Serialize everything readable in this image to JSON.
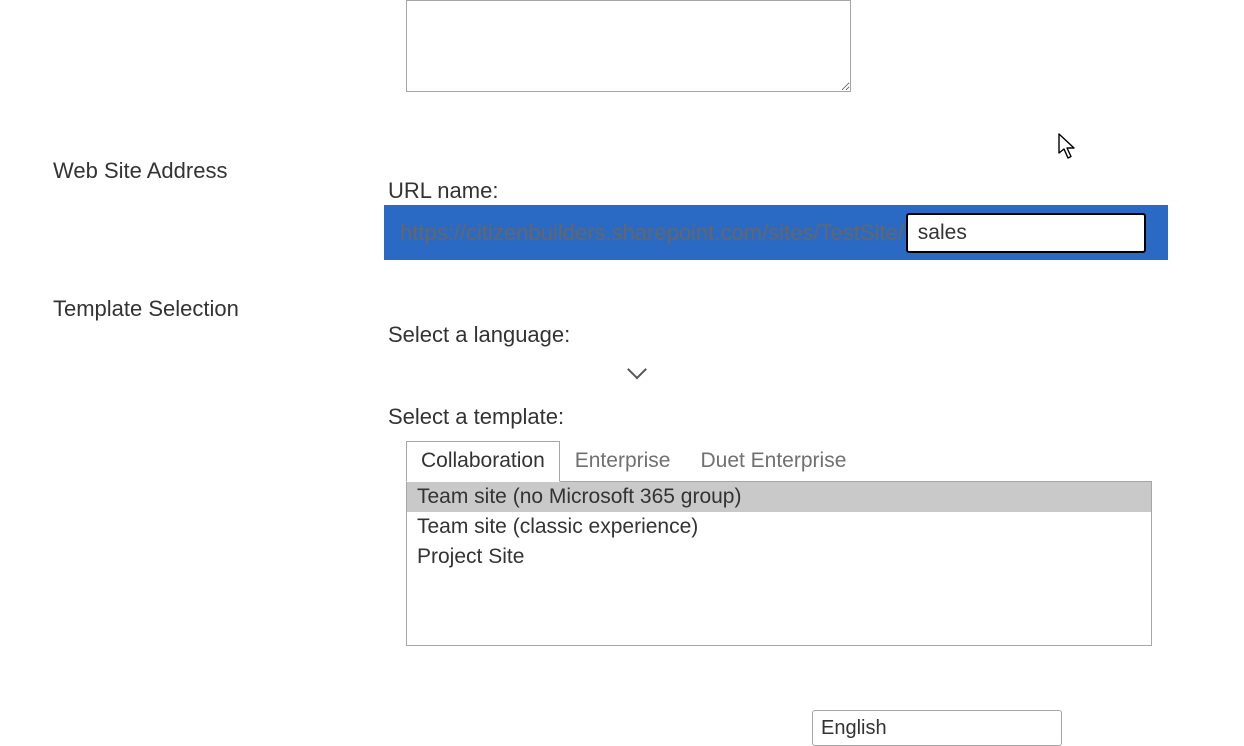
{
  "sections": {
    "web_site_address": "Web Site Address",
    "template_selection": "Template Selection"
  },
  "description": {
    "value": ""
  },
  "url": {
    "label": "URL name:",
    "prefix": "https://citizenbuilders.sharepoint.com/sites/TestSite/",
    "value": "sales"
  },
  "language": {
    "label": "Select a language:",
    "selected": "English",
    "options": [
      "English"
    ]
  },
  "template": {
    "label": "Select a template:",
    "tabs": [
      {
        "label": "Collaboration",
        "active": true
      },
      {
        "label": "Enterprise",
        "active": false
      },
      {
        "label": "Duet Enterprise",
        "active": false
      }
    ],
    "options": [
      {
        "label": "Team site (no Microsoft 365 group)",
        "selected": true
      },
      {
        "label": "Team site (classic experience)",
        "selected": false
      },
      {
        "label": "Project Site",
        "selected": false
      }
    ]
  },
  "colors": {
    "highlight": "#2a6ac4"
  }
}
